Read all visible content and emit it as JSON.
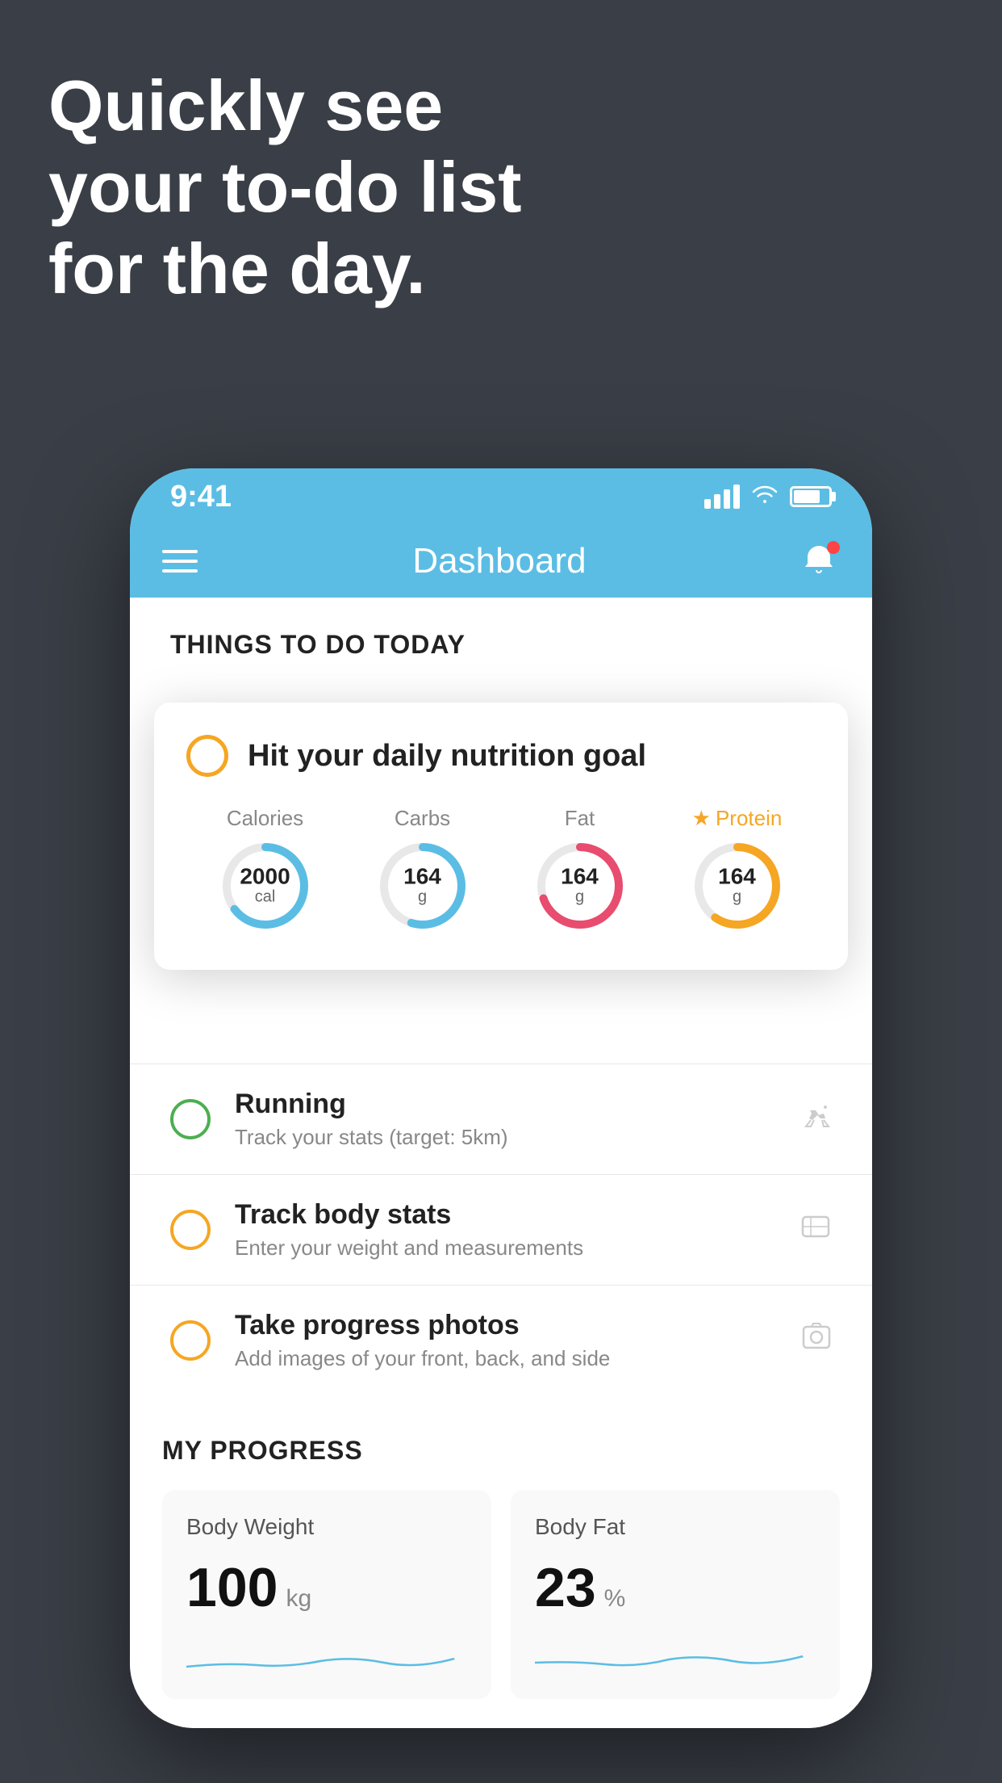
{
  "background": {
    "headline_line1": "Quickly see",
    "headline_line2": "your to-do list",
    "headline_line3": "for the day."
  },
  "status_bar": {
    "time": "9:41"
  },
  "nav": {
    "title": "Dashboard"
  },
  "things_header": "THINGS TO DO TODAY",
  "featured_card": {
    "title": "Hit your daily nutrition goal",
    "nutrients": [
      {
        "label": "Calories",
        "value": "2000",
        "unit": "cal",
        "color": "#5bbde4",
        "percent": 65,
        "starred": false
      },
      {
        "label": "Carbs",
        "value": "164",
        "unit": "g",
        "color": "#5bbde4",
        "percent": 55,
        "starred": false
      },
      {
        "label": "Fat",
        "value": "164",
        "unit": "g",
        "color": "#e84c6e",
        "percent": 70,
        "starred": false
      },
      {
        "label": "Protein",
        "value": "164",
        "unit": "g",
        "color": "#f5a623",
        "percent": 60,
        "starred": true
      }
    ]
  },
  "todo_items": [
    {
      "title": "Running",
      "subtitle": "Track your stats (target: 5km)",
      "circle_color": "green"
    },
    {
      "title": "Track body stats",
      "subtitle": "Enter your weight and measurements",
      "circle_color": "yellow"
    },
    {
      "title": "Take progress photos",
      "subtitle": "Add images of your front, back, and side",
      "circle_color": "yellow"
    }
  ],
  "progress": {
    "header": "MY PROGRESS",
    "cards": [
      {
        "title": "Body Weight",
        "value": "100",
        "unit": "kg"
      },
      {
        "title": "Body Fat",
        "value": "23",
        "unit": "%"
      }
    ]
  }
}
